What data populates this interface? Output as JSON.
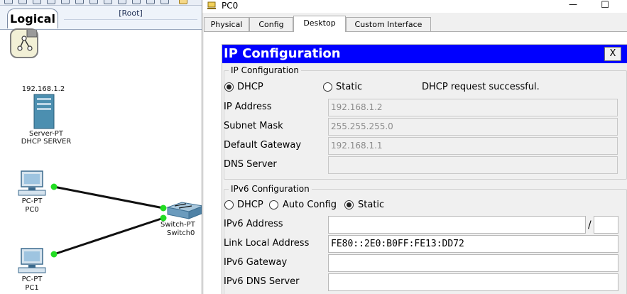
{
  "workspace": {
    "tab_label": "Logical",
    "root_label": "[Root]",
    "devices": {
      "server": {
        "ip": "192.168.1.2",
        "model": "Server-PT",
        "name": "DHCP SERVER"
      },
      "pc0": {
        "model": "PC-PT",
        "name": "PC0"
      },
      "switch0": {
        "model": "Switch-PT",
        "name": "Switch0"
      },
      "pc1": {
        "model": "PC-PT",
        "name": "PC1"
      }
    },
    "link_color": "#111111",
    "link_light_color": "#22dd22"
  },
  "window": {
    "title": "PC0",
    "minimize_glyph": "—",
    "maximize_glyph": "☐",
    "tabs": [
      {
        "label": "Physical",
        "active": false
      },
      {
        "label": "Config",
        "active": false
      },
      {
        "label": "Desktop",
        "active": true
      },
      {
        "label": "Custom Interface",
        "active": false
      }
    ]
  },
  "ip_config": {
    "title": "IP Configuration",
    "close_label": "X",
    "title_bar_color": "#0000ff",
    "ipv4": {
      "legend": "IP Configuration",
      "mode_dhcp": "DHCP",
      "mode_static": "Static",
      "selected_mode": "DHCP",
      "status": "DHCP request successful.",
      "ip_address_label": "IP Address",
      "ip_address": "192.168.1.2",
      "subnet_mask_label": "Subnet Mask",
      "subnet_mask": "255.255.255.0",
      "default_gateway_label": "Default Gateway",
      "default_gateway": "192.168.1.1",
      "dns_server_label": "DNS Server",
      "dns_server": ""
    },
    "ipv6": {
      "legend": "IPv6 Configuration",
      "mode_dhcp": "DHCP",
      "mode_auto": "Auto Config",
      "mode_static": "Static",
      "selected_mode": "Static",
      "address_label": "IPv6 Address",
      "address": "",
      "prefix_separator": "/",
      "prefix_length": "",
      "link_local_label": "Link Local Address",
      "link_local": "FE80::2E0:B0FF:FE13:DD72",
      "gateway_label": "IPv6 Gateway",
      "gateway": "",
      "dns_label": "IPv6 DNS Server",
      "dns": ""
    }
  }
}
